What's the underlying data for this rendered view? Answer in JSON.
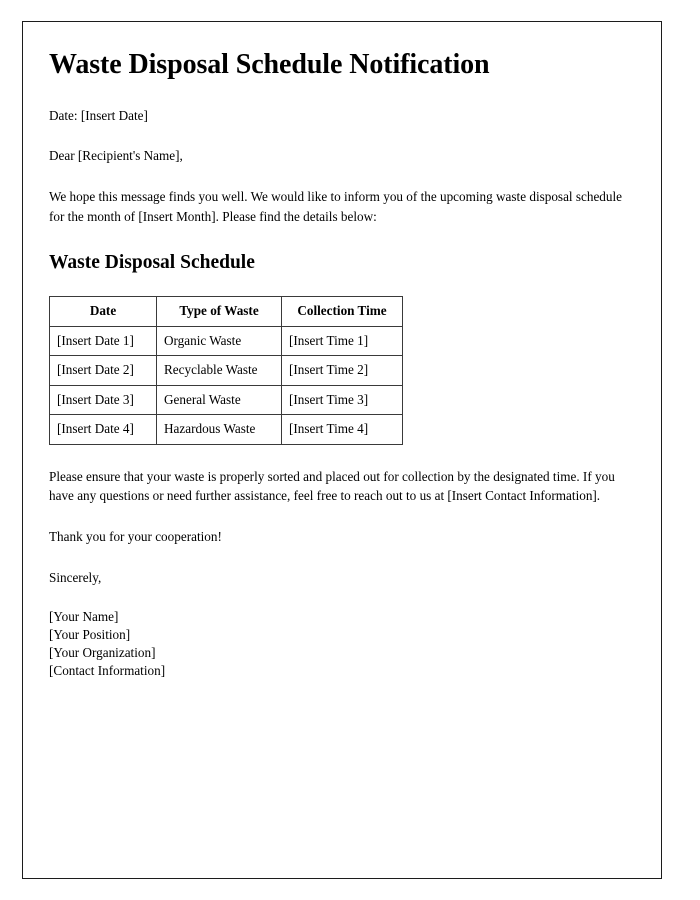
{
  "document": {
    "title": "Waste Disposal Schedule Notification",
    "date_line": "Date: [Insert Date]",
    "salutation": "Dear [Recipient's Name],",
    "intro_paragraph": "We hope this message finds you well. We would like to inform you of the upcoming waste disposal schedule for the month of [Insert Month]. Please find the details below:",
    "section_heading": "Waste Disposal Schedule",
    "instructions_paragraph": "Please ensure that your waste is properly sorted and placed out for collection by the designated time. If you have any questions or need further assistance, feel free to reach out to us at [Insert Contact Information].",
    "thanks_line": "Thank you for your cooperation!",
    "closing_line": "Sincerely,",
    "signature": {
      "name": "[Your Name]",
      "position": "[Your Position]",
      "organization": "[Your Organization]",
      "contact": "[Contact Information]"
    }
  },
  "schedule_table": {
    "headers": {
      "date": "Date",
      "type": "Type of Waste",
      "time": "Collection Time"
    },
    "rows": [
      {
        "date": "[Insert Date 1]",
        "type": "Organic Waste",
        "time": "[Insert Time 1]"
      },
      {
        "date": "[Insert Date 2]",
        "type": "Recyclable Waste",
        "time": "[Insert Time 2]"
      },
      {
        "date": "[Insert Date 3]",
        "type": "General Waste",
        "time": "[Insert Time 3]"
      },
      {
        "date": "[Insert Date 4]",
        "type": "Hazardous Waste",
        "time": "[Insert Time 4]"
      }
    ]
  },
  "colors": {
    "page_background": "#ffffff",
    "text": "#000000",
    "page_border": "#1c1c1c",
    "table_border": "#141414",
    "table_cell_border": "#3a3a3a"
  }
}
